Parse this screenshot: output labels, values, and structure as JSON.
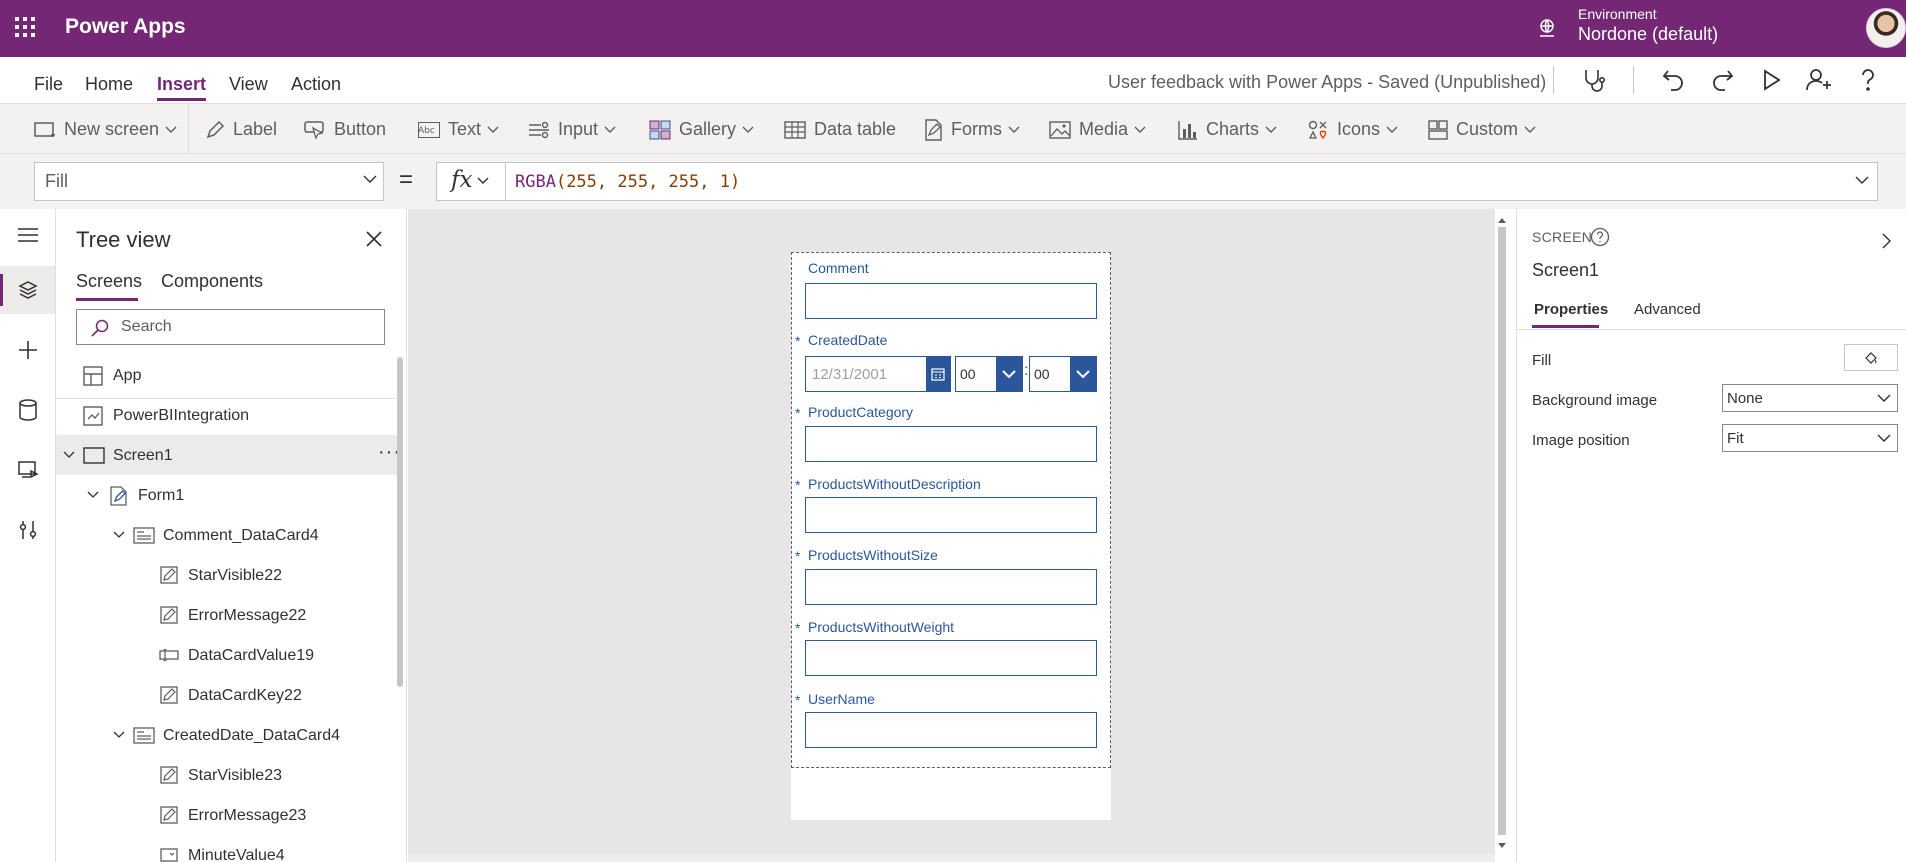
{
  "app": {
    "title": "Power Apps",
    "environment_label": "Environment",
    "environment_value": "Nordone (default)"
  },
  "menu": {
    "items": [
      "File",
      "Home",
      "Insert",
      "View",
      "Action"
    ],
    "active": "Insert",
    "document_title": "User feedback with Power Apps - Saved (Unpublished)"
  },
  "ribbon": {
    "new_screen": "New screen",
    "label": "Label",
    "button": "Button",
    "text": "Text",
    "input": "Input",
    "gallery": "Gallery",
    "data_table": "Data table",
    "forms": "Forms",
    "media": "Media",
    "charts": "Charts",
    "icons": "Icons",
    "custom": "Custom"
  },
  "formula_bar": {
    "property": "Fill",
    "equals": "=",
    "fx": "fx",
    "formula_fn": "RGBA",
    "formula_args": "(255, 255, 255, 1)"
  },
  "tree_view": {
    "title": "Tree view",
    "tabs": [
      "Screens",
      "Components"
    ],
    "active_tab": "Screens",
    "search_placeholder": "Search",
    "items": [
      {
        "label": "App",
        "icon": "app-icon",
        "depth": 0
      },
      {
        "label": "PowerBIIntegration",
        "icon": "powerbi-integration-icon",
        "depth": 0
      },
      {
        "label": "Screen1",
        "icon": "screen-icon",
        "depth": 0,
        "expanded": true,
        "selected": true
      },
      {
        "label": "Form1",
        "icon": "form-icon",
        "depth": 1,
        "expanded": true
      },
      {
        "label": "Comment_DataCard4",
        "icon": "datacard-icon",
        "depth": 2,
        "expanded": true
      },
      {
        "label": "StarVisible22",
        "icon": "label-edit-icon",
        "depth": 3
      },
      {
        "label": "ErrorMessage22",
        "icon": "label-edit-icon",
        "depth": 3
      },
      {
        "label": "DataCardValue19",
        "icon": "text-input-icon",
        "depth": 3
      },
      {
        "label": "DataCardKey22",
        "icon": "label-edit-icon",
        "depth": 3
      },
      {
        "label": "CreatedDate_DataCard4",
        "icon": "datacard-icon",
        "depth": 2,
        "expanded": true
      },
      {
        "label": "StarVisible23",
        "icon": "label-edit-icon",
        "depth": 3
      },
      {
        "label": "ErrorMessage23",
        "icon": "label-edit-icon",
        "depth": 3
      },
      {
        "label": "MinuteValue4",
        "icon": "dropdown-icon",
        "depth": 3
      }
    ]
  },
  "form": {
    "fields": [
      {
        "label": "Comment",
        "required": false,
        "value": ""
      },
      {
        "label": "CreatedDate",
        "required": true,
        "type": "datetime"
      },
      {
        "label": "ProductCategory",
        "required": true,
        "value": ""
      },
      {
        "label": "ProductsWithoutDescription",
        "required": true,
        "value": ""
      },
      {
        "label": "ProductsWithoutSize",
        "required": true,
        "value": ""
      },
      {
        "label": "ProductsWithoutWeight",
        "required": true,
        "value": ""
      },
      {
        "label": "UserName",
        "required": true,
        "value": ""
      }
    ],
    "star": "*",
    "date_value": "12/31/2001",
    "hour_value": "00",
    "minute_value": "00",
    "time_separator": ":"
  },
  "properties": {
    "kind": "SCREEN",
    "name": "Screen1",
    "tabs": [
      "Properties",
      "Advanced"
    ],
    "active_tab": "Properties",
    "rows": [
      {
        "label": "Fill",
        "value": ""
      },
      {
        "label": "Background image",
        "value": "None"
      },
      {
        "label": "Image position",
        "value": "Fit"
      }
    ]
  },
  "colors": {
    "brand": "#742774",
    "form_accent": "#2b579a",
    "canvas": "#e6e6e6"
  }
}
